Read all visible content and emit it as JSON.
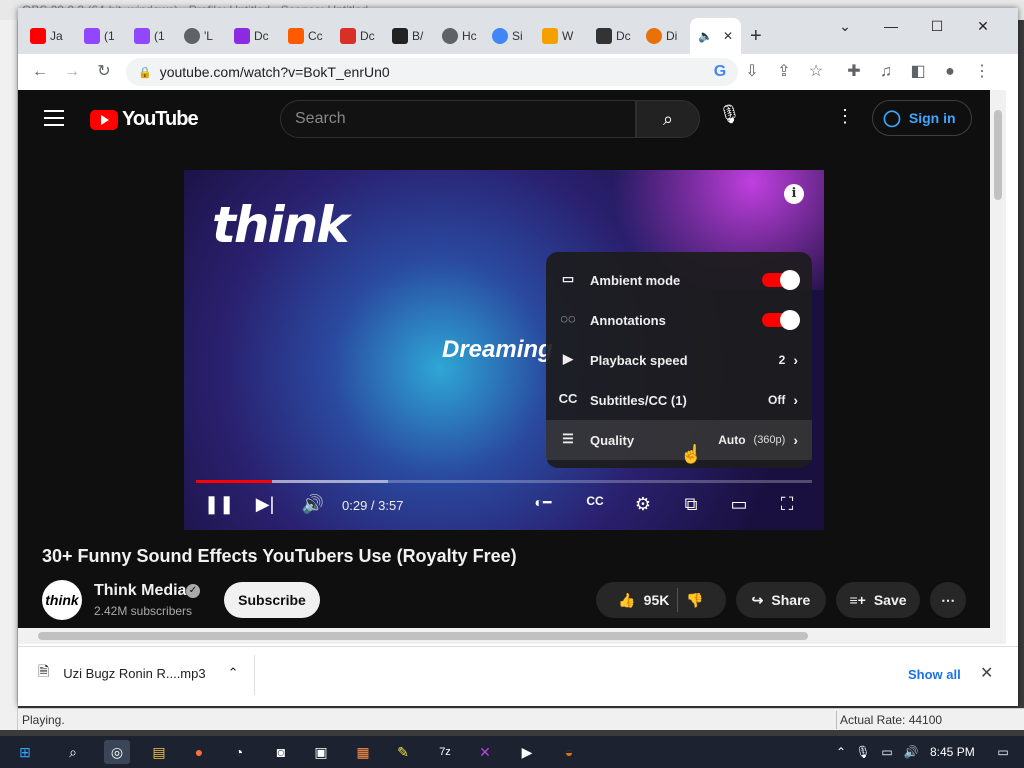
{
  "obs": {
    "title": "OBS 29.0.2 (64-bit, windows) - Profile: Untitled - Scenes: Untitled",
    "status_left": "Playing.",
    "status_right": "Actual Rate: 44100"
  },
  "browser": {
    "tabs": [
      {
        "label": "Ja",
        "icon": "youtube-icon",
        "color": "#ff0000"
      },
      {
        "label": "(1",
        "icon": "twitch-icon",
        "color": "#9146ff"
      },
      {
        "label": "(1",
        "icon": "twitch-icon",
        "color": "#9146ff"
      },
      {
        "label": "'L",
        "icon": "globe-icon",
        "color": "#5f6368"
      },
      {
        "label": "Dc",
        "icon": "x-icon",
        "color": "#8a2be2"
      },
      {
        "label": "Cc",
        "icon": "square-icon",
        "color": "#ff5a00"
      },
      {
        "label": "Dc",
        "icon": "bus-icon",
        "color": "#d93025"
      },
      {
        "label": "B/",
        "icon": "dark-icon",
        "color": "#222222"
      },
      {
        "label": "Hc",
        "icon": "globe-icon",
        "color": "#5f6368"
      },
      {
        "label": "Si",
        "icon": "google-icon",
        "color": "#4285f4"
      },
      {
        "label": "W",
        "icon": "headphone-icon",
        "color": "#f4a100"
      },
      {
        "label": "Dc",
        "icon": "download-icon",
        "color": "#333333"
      },
      {
        "label": "Di",
        "icon": "app-icon",
        "color": "#e8710a"
      }
    ],
    "url": "youtube.com/watch?v=BokT_enrUn0"
  },
  "youtube": {
    "logo_text": "YouTube",
    "search_placeholder": "Search",
    "sign_in": "Sign in",
    "player": {
      "brand": "think",
      "overlay_text": "Dreaming",
      "time": "0:29 / 3:57",
      "progress_played": 0.1234,
      "progress_buffered": 0.3115
    },
    "settings": [
      {
        "label": "Ambient mode",
        "type": "toggle",
        "on": true
      },
      {
        "label": "Annotations",
        "type": "toggle",
        "on": true
      },
      {
        "label": "Playback speed",
        "value": "2"
      },
      {
        "label": "Subtitles/CC (1)",
        "value": "Off"
      },
      {
        "label": "Quality",
        "value": "Auto",
        "value_detail": "(360p)"
      }
    ],
    "video_title": "30+ Funny Sound Effects YouTubers Use (Royalty Free)",
    "channel": {
      "avatar_text": "think",
      "name": "Think Media",
      "subscribers": "2.42M subscribers",
      "subscribe_label": "Subscribe"
    },
    "likes": "95K",
    "share_label": "Share",
    "save_label": "Save"
  },
  "downloads": {
    "file": "Uzi Bugz Ronin R....mp3",
    "show_all": "Show all"
  },
  "taskbar": {
    "time": "8:45 PM"
  },
  "colors": {
    "yt_red": "#ff0000",
    "link_blue": "#3ea6ff",
    "chrome_blue": "#1a73e8"
  }
}
